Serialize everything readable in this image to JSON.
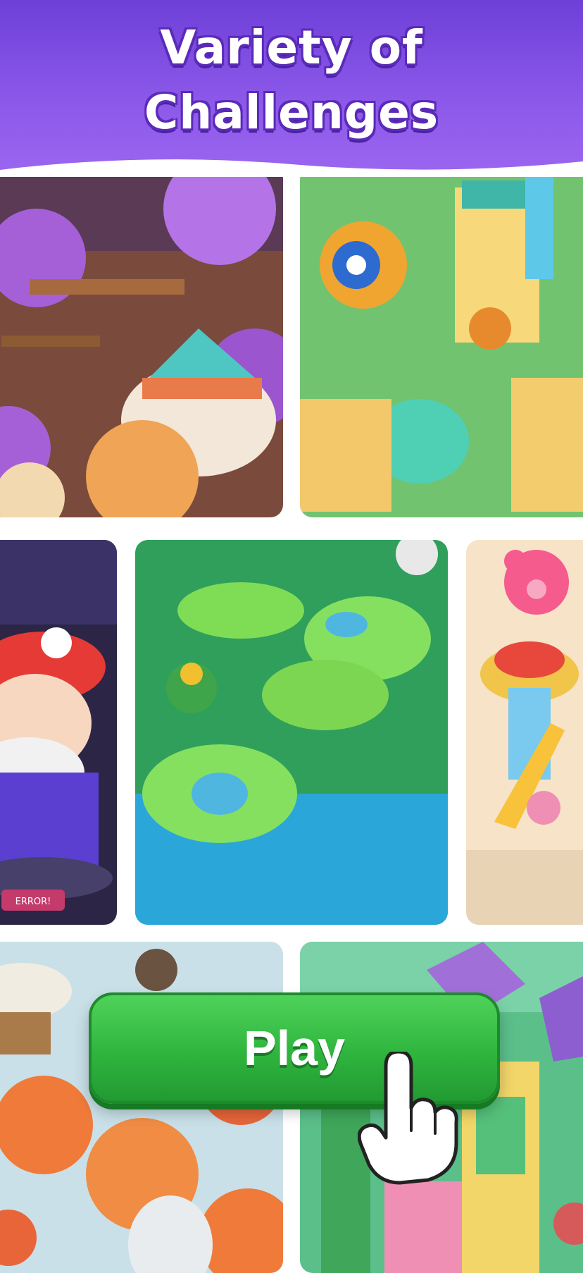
{
  "banner": {
    "title_line1": "Variety of",
    "title_line2": "Challenges",
    "color_top": "#6e40d8",
    "color_bottom": "#9b66f0"
  },
  "tiles": [
    {
      "name": "treehouse-forest-scene",
      "palette": "purple-trees"
    },
    {
      "name": "egyptian-temple-scene",
      "palette": "gold-green"
    },
    {
      "name": "arcade-plumber-scene",
      "palette": "red-purple",
      "sign_text": "ERROR!"
    },
    {
      "name": "lily-pond-frog-king-scene",
      "palette": "green-blue"
    },
    {
      "name": "toyland-teddy-bear-scene",
      "palette": "pink-yellow"
    },
    {
      "name": "autumn-airship-scene",
      "palette": "orange-white"
    },
    {
      "name": "emerald-castle-scene",
      "palette": "green-purple"
    }
  ],
  "play_button": {
    "label": "Play",
    "color": "#2fb53e"
  },
  "hand_cursor": {
    "icon": "pointing-hand-icon"
  }
}
